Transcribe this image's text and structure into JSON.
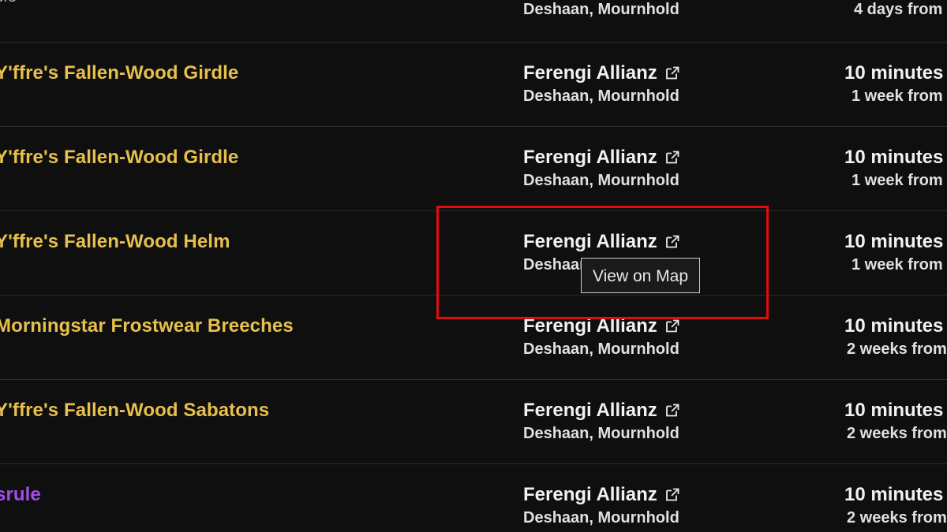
{
  "header_partial": {
    "sub_text": "ers",
    "location": "Deshaan, Mournhold",
    "time": "4 days from"
  },
  "rows": [
    {
      "item": "Y'ffre's Fallen-Wood Girdle",
      "guild": "Ferengi Allianz",
      "location": "Deshaan, Mournhold",
      "time_main": "10 minutes",
      "time_sub": "1 week from"
    },
    {
      "item": "Y'ffre's Fallen-Wood Girdle",
      "guild": "Ferengi Allianz",
      "location": "Deshaan, Mournhold",
      "time_main": "10 minutes",
      "time_sub": "1 week from"
    },
    {
      "item": "Y'ffre's Fallen-Wood Helm",
      "guild": "Ferengi Allianz",
      "location": "Deshaan, Mournhold",
      "time_main": "10 minutes",
      "time_sub": "1 week from"
    },
    {
      "item": "Morningstar Frostwear Breeches",
      "guild": "Ferengi Allianz",
      "location": "Deshaan, Mournhold",
      "time_main": "10 minutes",
      "time_sub": "2 weeks from"
    },
    {
      "item": "Y'ffre's Fallen-Wood Sabatons",
      "guild": "Ferengi Allianz",
      "location": "Deshaan, Mournhold",
      "time_main": "10 minutes",
      "time_sub": "2 weeks from"
    },
    {
      "item": "srule",
      "guild": "Ferengi Allianz",
      "location": "Deshaan, Mournhold",
      "time_main": "10 minutes",
      "time_sub": "2 weeks from"
    }
  ],
  "tooltip": {
    "text": "View on Map"
  },
  "colors": {
    "background": "#0f0f10",
    "item_gold": "#e7c04c",
    "item_purple": "#a14ee8",
    "highlight_red": "#e00d0d"
  },
  "icons": {
    "guild_link": "external-link-icon"
  }
}
